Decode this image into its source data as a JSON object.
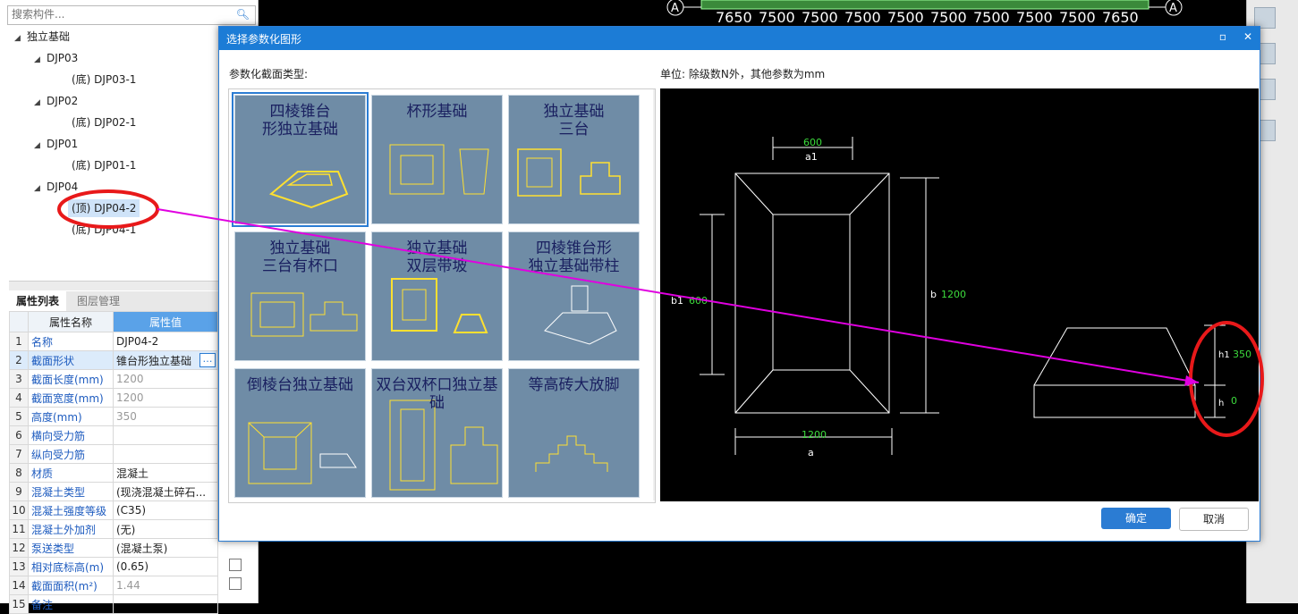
{
  "search": {
    "placeholder": "搜索构件..."
  },
  "tree": {
    "root": "独立基础",
    "groups": [
      {
        "label": "DJP03",
        "child": "(底)  DJP03-1"
      },
      {
        "label": "DJP02",
        "child": "(底)  DJP02-1"
      },
      {
        "label": "DJP01",
        "child": "(底)  DJP01-1"
      },
      {
        "label": "DJP04",
        "child_top": "(顶)  DJP04-2",
        "child": "(底)  DJP04-1"
      }
    ]
  },
  "props": {
    "tabs": [
      "属性列表",
      "图层管理"
    ],
    "headers": {
      "name": "属性名称",
      "value": "属性值"
    },
    "rows": [
      {
        "n": "1",
        "k": "名称",
        "v": "DJP04-2"
      },
      {
        "n": "2",
        "k": "截面形状",
        "v": "锥台形独立基础"
      },
      {
        "n": "3",
        "k": "截面长度(mm)",
        "v": "1200"
      },
      {
        "n": "4",
        "k": "截面宽度(mm)",
        "v": "1200"
      },
      {
        "n": "5",
        "k": "高度(mm)",
        "v": "350"
      },
      {
        "n": "6",
        "k": "横向受力筋",
        "v": ""
      },
      {
        "n": "7",
        "k": "纵向受力筋",
        "v": ""
      },
      {
        "n": "8",
        "k": "材质",
        "v": "混凝土"
      },
      {
        "n": "9",
        "k": "混凝土类型",
        "v": "(现浇混凝土碎石..."
      },
      {
        "n": "10",
        "k": "混凝土强度等级",
        "v": "(C35)"
      },
      {
        "n": "11",
        "k": "混凝土外加剂",
        "v": "(无)"
      },
      {
        "n": "12",
        "k": "泵送类型",
        "v": "(混凝土泵)"
      },
      {
        "n": "13",
        "k": "相对底标高(m)",
        "v": "(0.65)"
      },
      {
        "n": "14",
        "k": "截面面积(m²)",
        "v": "1.44"
      },
      {
        "n": "15",
        "k": "备注",
        "v": ""
      }
    ]
  },
  "dialog": {
    "title": "选择参数化图形",
    "section_label": "参数化截面类型:",
    "unit_label": "单位:   除级数N外，其他参数为mm",
    "ok": "确定",
    "cancel": "取消",
    "thumbnails": [
      {
        "title": [
          "四棱锥台",
          "形独立基础"
        ]
      },
      {
        "title": [
          "杯形基础"
        ]
      },
      {
        "title": [
          "独立基础",
          "三台"
        ]
      },
      {
        "title": [
          "独立基础",
          "三台有杯口"
        ]
      },
      {
        "title": [
          "独立基础",
          "双层带坡"
        ]
      },
      {
        "title": [
          "四棱锥台形",
          "独立基础带柱"
        ]
      },
      {
        "title": [
          "倒棱台独立基础"
        ]
      },
      {
        "title": [
          "双台双杯口独立基础"
        ]
      },
      {
        "title": [
          "等高砖大放脚"
        ]
      }
    ],
    "preview": {
      "a1": "600",
      "a1_label": "a1",
      "b1": "600",
      "b1_label": "b1",
      "b": "1200",
      "b_label": "b",
      "a": "1200",
      "a_label": "a",
      "h1": "350",
      "h1_label": "h1",
      "h": "0",
      "h_label": "h"
    }
  },
  "cad_top": {
    "dims": [
      "7650",
      "7500",
      "7500",
      "7500",
      "7500",
      "7500",
      "7500",
      "7500",
      "7500",
      "7650"
    ],
    "axis": "A"
  },
  "colors": {
    "accent": "#1c7cd6",
    "annotation": "#e8191a",
    "arrow": "#e000e0",
    "dim": "#3ddc3d"
  }
}
